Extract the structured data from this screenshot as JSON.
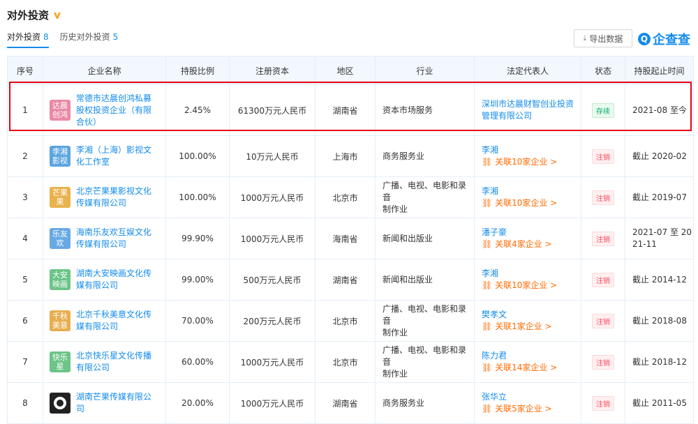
{
  "section": {
    "title": "对外投资"
  },
  "tabs": [
    {
      "label": "对外投资",
      "count": "8"
    },
    {
      "label": "历史对外投资",
      "count": "5"
    }
  ],
  "toolbar": {
    "export_label": "导出数据",
    "logo_text": "企查查"
  },
  "table": {
    "headers": [
      "序号",
      "企业名称",
      "持股比例",
      "注册资本",
      "地区",
      "行业",
      "法定代表人",
      "状态",
      "持股起止时间"
    ],
    "rows": [
      {
        "no": "1",
        "avatar": "达晨创鸿",
        "avatar_color": "#e98aa4",
        "name_l1": "常德市达晨创鸿私募",
        "name_l2": "股权投资企业（有限",
        "name_l3": "合伙）",
        "ratio": "2.45%",
        "capital": "61300万元人民币",
        "region": "湖南省",
        "industry_l1": "资本市场服务",
        "industry_l2": "",
        "rep": "深圳市达晨财智创业投资",
        "rep_l2": "管理有限公司",
        "rel": "",
        "status": "存续",
        "period": "2021-08 至今",
        "period_l2": ""
      },
      {
        "no": "2",
        "avatar": "李湘影视",
        "avatar_color": "#5ca5de",
        "name_l1": "李湘（上海）影视文",
        "name_l2": "化工作室",
        "name_l3": "",
        "ratio": "100.00%",
        "capital": "10万元人民币",
        "region": "上海市",
        "industry_l1": "商务服务业",
        "industry_l2": "",
        "rep": "李湘",
        "rep_l2": "",
        "rel": "关联10家企业 >",
        "status": "注销",
        "period": "截止 2020-02",
        "period_l2": ""
      },
      {
        "no": "3",
        "avatar": "芒果果",
        "avatar_color": "#e9b24d",
        "name_l1": "北京芒果果影视文化",
        "name_l2": "传媒有限公司",
        "name_l3": "",
        "ratio": "100.00%",
        "capital": "1000万元人民币",
        "region": "北京市",
        "industry_l1": "广播、电视、电影和录音",
        "industry_l2": "制作业",
        "rep": "李湘",
        "rep_l2": "",
        "rel": "关联10家企业 >",
        "status": "注销",
        "period": "截止 2019-07",
        "period_l2": ""
      },
      {
        "no": "4",
        "avatar": "乐友欢",
        "avatar_color": "#68a9e3",
        "name_l1": "海南乐友欢互娱文化",
        "name_l2": "传媒有限公司",
        "name_l3": "",
        "ratio": "99.90%",
        "capital": "1000万元人民币",
        "region": "海南省",
        "industry_l1": "新闻和出版业",
        "industry_l2": "",
        "rep": "潘子豪",
        "rep_l2": "",
        "rel": "关联4家企业 >",
        "status": "注销",
        "period": "2021-07 至 20",
        "period_l2": "21-11"
      },
      {
        "no": "5",
        "avatar": "大安映画",
        "avatar_color": "#6cc487",
        "name_l1": "湖南大安映画文化传",
        "name_l2": "媒有限公司",
        "name_l3": "",
        "ratio": "99.00%",
        "capital": "500万元人民币",
        "region": "湖南省",
        "industry_l1": "新闻和出版业",
        "industry_l2": "",
        "rep": "李湘",
        "rep_l2": "",
        "rel": "关联10家企业 >",
        "status": "注销",
        "period": "截止 2014-12",
        "period_l2": ""
      },
      {
        "no": "6",
        "avatar": "千秋美意",
        "avatar_color": "#e7ae4f",
        "name_l1": "北京千秋美意文化传",
        "name_l2": "媒有限公司",
        "name_l3": "",
        "ratio": "70.00%",
        "capital": "200万元人民币",
        "region": "北京市",
        "industry_l1": "广播、电视、电影和录音",
        "industry_l2": "制作业",
        "rep": "樊孝文",
        "rep_l2": "",
        "rel": "关联1家企业 >",
        "status": "注销",
        "period": "截止 2018-08",
        "period_l2": ""
      },
      {
        "no": "7",
        "avatar": "快乐星",
        "avatar_color": "#6cc487",
        "name_l1": "北京快乐星文化传播",
        "name_l2": "有限公司",
        "name_l3": "",
        "ratio": "60.00%",
        "capital": "1000万元人民币",
        "region": "北京市",
        "industry_l1": "广播、电视、电影和录音",
        "industry_l2": "制作业",
        "rep": "陈力君",
        "rep_l2": "",
        "rel": "关联14家企业 >",
        "status": "注销",
        "period": "截止 2018-12",
        "period_l2": ""
      },
      {
        "no": "8",
        "avatar": "",
        "avatar_color": "#222222",
        "name_l1": "湖南芒果传媒有限公",
        "name_l2": "司",
        "name_l3": "",
        "ratio": "20.00%",
        "capital": "1000万元人民币",
        "region": "湖南省",
        "industry_l1": "商务服务业",
        "industry_l2": "",
        "rep": "张华立",
        "rep_l2": "",
        "rel": "关联5家企业 >",
        "status": "注销",
        "period": "截止 2011-05",
        "period_l2": ""
      }
    ]
  },
  "colors": {
    "accent": "#128bed",
    "highlight": "#e60012",
    "status_ok": "#00ad65",
    "status_closed": "#fd485e",
    "relation": "#ff6a00"
  }
}
